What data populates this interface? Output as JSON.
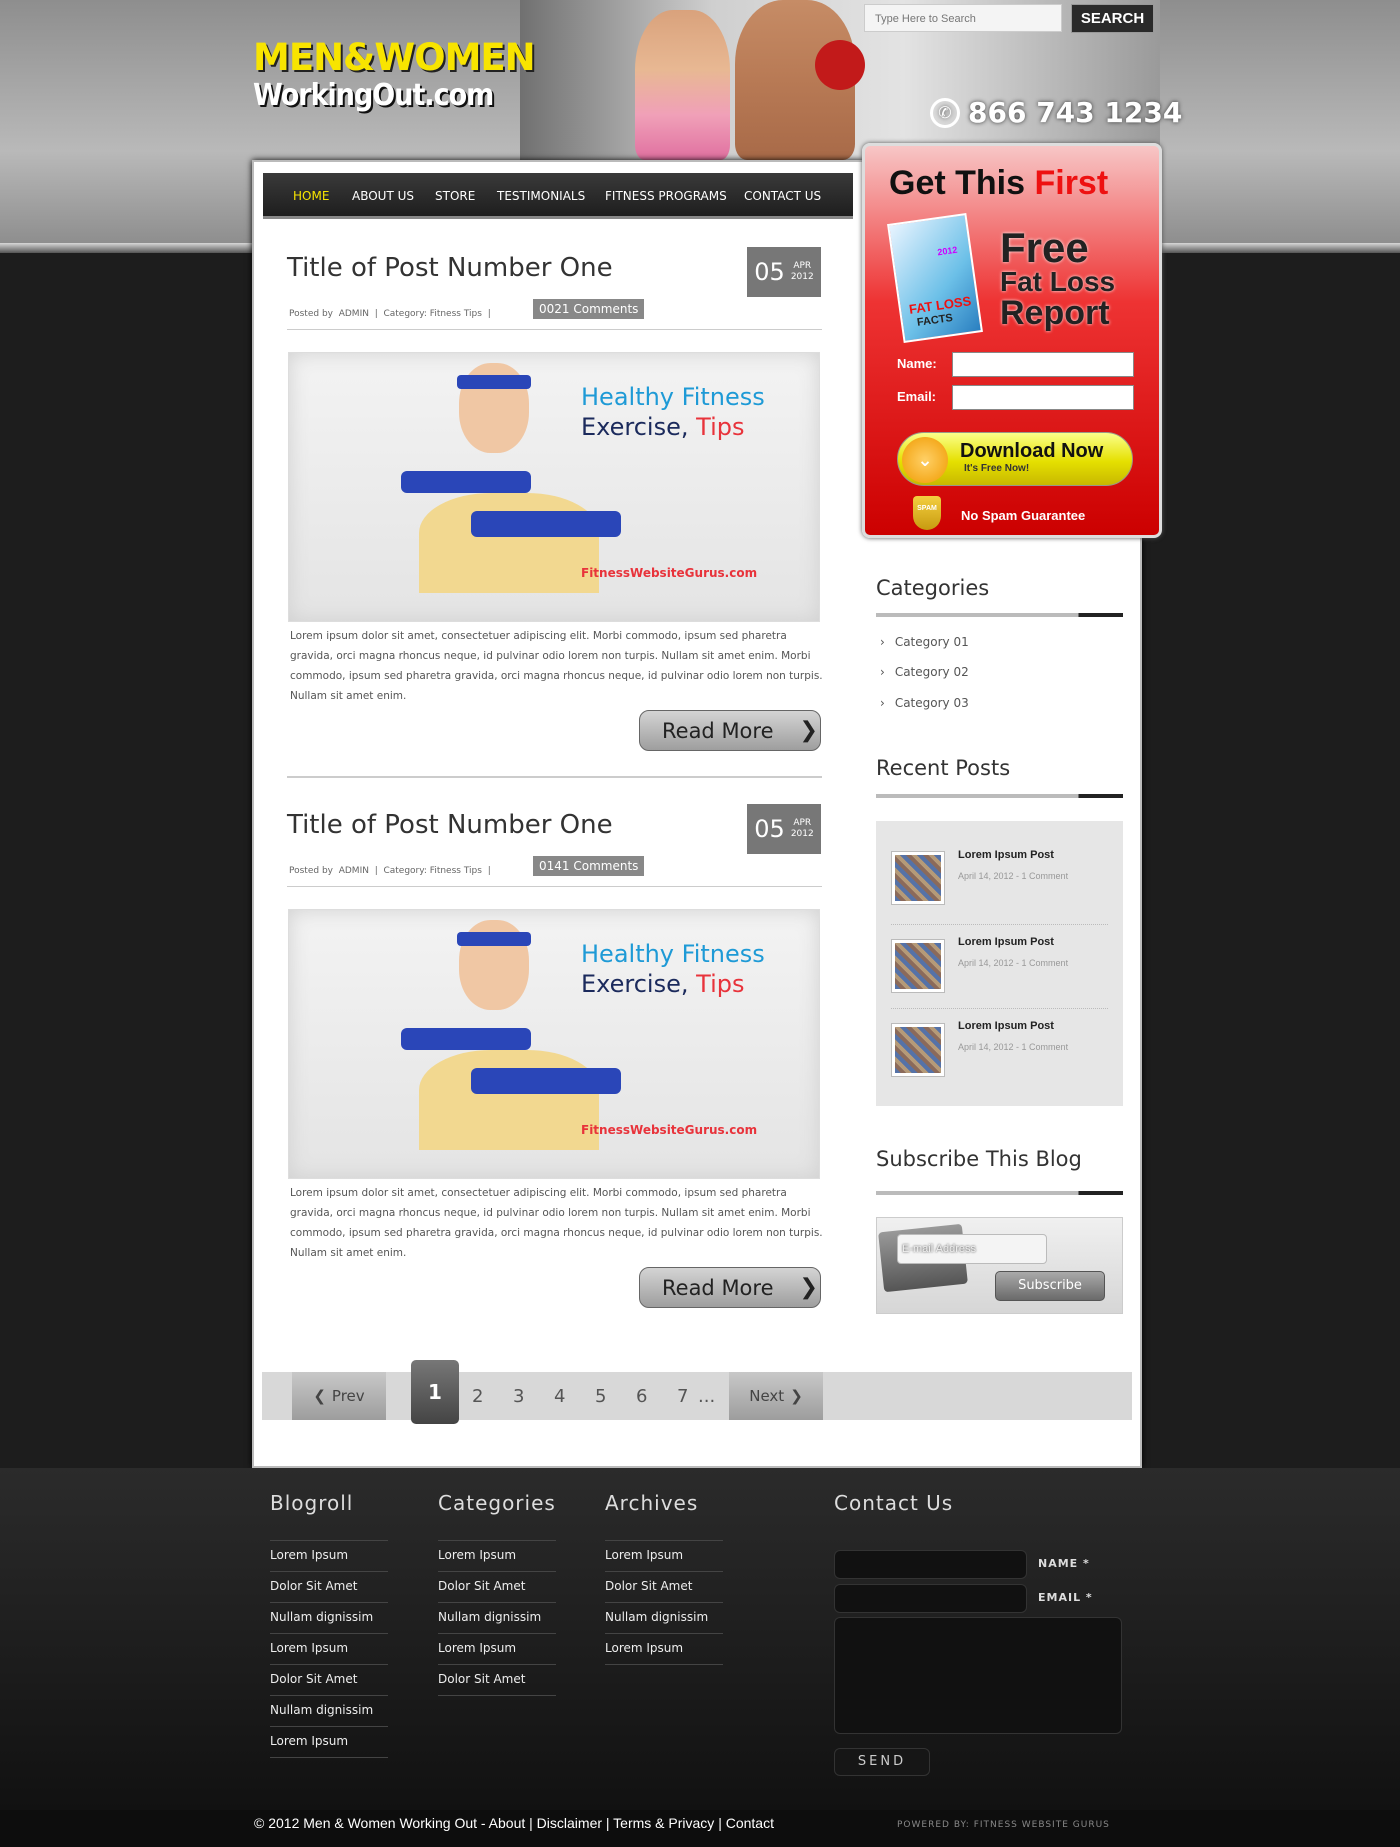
{
  "header": {
    "logo_line1": "MEN&WOMEN",
    "logo_line2": "WorkingOut.com",
    "phone": "866 743 1234",
    "search_placeholder": "Type Here to Search",
    "search_button": "SEARCH"
  },
  "nav": {
    "items": [
      "HOME",
      "ABOUT US",
      "STORE",
      "TESTIMONIALS",
      "FITNESS PROGRAMS",
      "CONTACT US"
    ],
    "active_color": "#f8e400"
  },
  "posts": [
    {
      "title": "Title of Post Number One",
      "day": "05",
      "month": "APR",
      "year": "2012",
      "meta_posted": "Posted by",
      "meta_author": "ADMIN",
      "meta_category": "Category: Fitness Tips",
      "comments": "0021 Comments",
      "image_line1": "Healthy Fitness",
      "image_line2a": "Exercise,",
      "image_line2b": "Tips",
      "image_site": "FitnessWebsiteGurus.com",
      "excerpt": "Lorem ipsum dolor sit amet, consectetuer adipiscing elit. Morbi commodo, ipsum sed pharetra gravida, orci magna rhoncus neque, id pulvinar odio lorem non turpis. Nullam sit amet enim. Morbi commodo, ipsum sed pharetra gravida, orci magna rhoncus neque, id pulvinar odio lorem non turpis. Nullam sit amet enim.",
      "read_more": "Read More"
    },
    {
      "title": "Title of Post Number One",
      "day": "05",
      "month": "APR",
      "year": "2012",
      "meta_posted": "Posted by",
      "meta_author": "ADMIN",
      "meta_category": "Category: Fitness Tips",
      "comments": "0141 Comments",
      "image_line1": "Healthy Fitness",
      "image_line2a": "Exercise,",
      "image_line2b": "Tips",
      "image_site": "FitnessWebsiteGurus.com",
      "excerpt": "Lorem ipsum dolor sit amet, consectetuer adipiscing elit. Morbi commodo, ipsum sed pharetra gravida, orci magna rhoncus neque, id pulvinar odio lorem non turpis. Nullam sit amet enim. Morbi commodo, ipsum sed pharetra gravida, orci magna rhoncus neque, id pulvinar odio lorem non turpis. Nullam sit amet enim.",
      "read_more": "Read More"
    }
  ],
  "optin": {
    "headline_a": "Get This",
    "headline_b": "First",
    "free_line1": "Free",
    "free_line2": "Fat Loss",
    "free_line3": "Report",
    "book_title1": "FAT LOSS",
    "book_title2": "FACTS",
    "book_year": "2012",
    "name_label": "Name:",
    "email_label": "Email:",
    "download_label": "Download Now",
    "download_sub": "It's Free Now!",
    "spam_badge": "SPAM",
    "spam_text": "No Spam Guarantee"
  },
  "sidebar": {
    "categories_heading": "Categories",
    "categories": [
      "Category 01",
      "Category 02",
      "Category 03"
    ],
    "recent_heading": "Recent Posts",
    "recent": [
      {
        "title": "Lorem Ipsum Post",
        "date": "April 14, 2012",
        "comments": "1 Comment"
      },
      {
        "title": "Lorem Ipsum Post",
        "date": "April 14, 2012",
        "comments": "1 Comment"
      },
      {
        "title": "Lorem Ipsum Post",
        "date": "April 14, 2012",
        "comments": "1 Comment"
      }
    ],
    "subscribe_heading": "Subscribe This Blog",
    "subscribe_placeholder": "E-mail Address",
    "subscribe_button": "Subscribe"
  },
  "pagination": {
    "prev": "Prev",
    "pages": [
      "1",
      "2",
      "3",
      "4",
      "5",
      "6",
      "7"
    ],
    "ellipsis": "...",
    "next": "Next"
  },
  "footer": {
    "blogroll_heading": "Blogroll",
    "blogroll": [
      "Lorem Ipsum",
      "Dolor Sit Amet",
      "Nullam dignissim",
      "Lorem Ipsum",
      "Dolor Sit Amet",
      "Nullam dignissim",
      "Lorem Ipsum"
    ],
    "categories_heading": "Categories",
    "categories": [
      "Lorem Ipsum",
      "Dolor Sit Amet",
      "Nullam dignissim",
      "Lorem Ipsum",
      "Dolor Sit Amet"
    ],
    "archives_heading": "Archives",
    "archives": [
      "Lorem Ipsum",
      "Dolor Sit Amet",
      "Nullam dignissim",
      "Lorem Ipsum"
    ],
    "contact_heading": "Contact Us",
    "name_label": "NAME *",
    "email_label": "EMAIL *",
    "send_label": "SEND",
    "copyright": "© 2012 Men & Women Working Out - About | Disclaimer | Terms & Privacy | Contact",
    "powered": "POWERED BY: FITNESS WEBSITE GURUS"
  },
  "colors": {
    "brand_yellow": "#f8e400",
    "accent_blue": "#1e9ad6",
    "accent_red": "#e8333b",
    "optin_red": "#dd2222"
  }
}
